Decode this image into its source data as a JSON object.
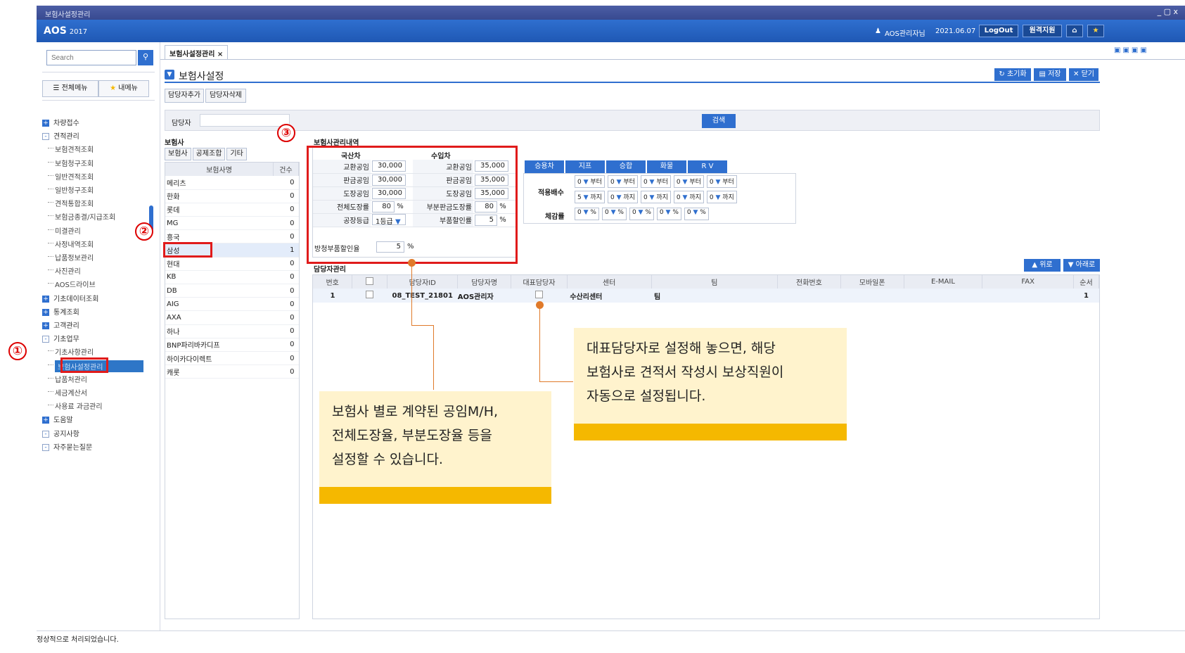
{
  "window": {
    "title": "보험사설정관리",
    "controls": "_ ▢ x"
  },
  "app": {
    "logo": "AOS",
    "year": "2017",
    "user": "AOS관리자님",
    "date": "2021.06.07",
    "logout": "LogOut",
    "remote": "원격지원"
  },
  "sidebar": {
    "search_placeholder": "Search",
    "tab_all": "전체메뉴",
    "tab_my": "내메뉴",
    "items": [
      {
        "label": "차량접수",
        "type": "plus"
      },
      {
        "label": "견적관리",
        "type": "minus"
      },
      {
        "label": "보험견적조회",
        "type": "sub"
      },
      {
        "label": "보험청구조회",
        "type": "sub"
      },
      {
        "label": "일반견적조회",
        "type": "sub"
      },
      {
        "label": "일반청구조회",
        "type": "sub"
      },
      {
        "label": "견적통합조회",
        "type": "sub"
      },
      {
        "label": "보험금종결/지급조회",
        "type": "sub"
      },
      {
        "label": "미결관리",
        "type": "sub"
      },
      {
        "label": "사정내역조회",
        "type": "sub"
      },
      {
        "label": "납품정보관리",
        "type": "sub"
      },
      {
        "label": "사진관리",
        "type": "sub"
      },
      {
        "label": "AOS드라이브",
        "type": "sub"
      },
      {
        "label": "기초데이터조회",
        "type": "plus"
      },
      {
        "label": "통계조회",
        "type": "plus"
      },
      {
        "label": "고객관리",
        "type": "plus"
      },
      {
        "label": "기초업무",
        "type": "minus"
      },
      {
        "label": "기초사항관리",
        "type": "sub"
      },
      {
        "label": "보험사설정관리",
        "type": "sub"
      },
      {
        "label": "납품처관리",
        "type": "sub"
      },
      {
        "label": "세금계산서",
        "type": "sub"
      },
      {
        "label": "사용료 과금관리",
        "type": "sub"
      },
      {
        "label": "도움말",
        "type": "plus"
      },
      {
        "label": "공지사항",
        "type": "minus"
      },
      {
        "label": "자주묻는질문",
        "type": "minus"
      }
    ]
  },
  "main": {
    "tab": "보험사설정관리 ×",
    "page_title": "보험사설정",
    "btn_reset": "초기화",
    "btn_save": "저장",
    "btn_close": "닫기",
    "btn_add_mgr": "담당자추가",
    "btn_del_mgr": "담당자삭제",
    "search_label": "담당자",
    "search_btn": "검색",
    "ins_section": "보험사",
    "ins_tabs": [
      "보험사",
      "공제조합",
      "기타"
    ],
    "ins_col_name": "보험사명",
    "ins_col_count": "건수",
    "insurers": [
      {
        "name": "메리츠",
        "count": "0"
      },
      {
        "name": "한화",
        "count": "0"
      },
      {
        "name": "롯데",
        "count": "0"
      },
      {
        "name": "MG",
        "count": "0"
      },
      {
        "name": "흥국",
        "count": "0"
      },
      {
        "name": "삼성",
        "count": "1"
      },
      {
        "name": "현대",
        "count": "0"
      },
      {
        "name": "KB",
        "count": "0"
      },
      {
        "name": "DB",
        "count": "0"
      },
      {
        "name": "AIG",
        "count": "0"
      },
      {
        "name": "AXA",
        "count": "0"
      },
      {
        "name": "하나",
        "count": "0"
      },
      {
        "name": "BNP파리바카디프",
        "count": "0"
      },
      {
        "name": "하이카다이렉트",
        "count": "0"
      },
      {
        "name": "캐롯",
        "count": "0"
      }
    ],
    "detail_title": "보험사관리내역",
    "dom_label": "국산차",
    "imp_label": "수입차",
    "rows": [
      {
        "l1": "교환공임",
        "v1": "30,000",
        "l2": "교환공임",
        "v2": "35,000"
      },
      {
        "l1": "판금공임",
        "v1": "30,000",
        "l2": "판금공임",
        "v2": "35,000"
      },
      {
        "l1": "도장공임",
        "v1": "30,000",
        "l2": "도장공임",
        "v2": "35,000"
      },
      {
        "l1": "전체도장률",
        "v1": "80",
        "l2": "부분판금도장률",
        "v2": "80"
      },
      {
        "l1": "공장등급",
        "v1": "1등급",
        "l2": "부품할인률",
        "v2": "5"
      }
    ],
    "rust_label": "방청부품할인율",
    "rust_value": "5",
    "pct": "%",
    "veh_tabs": [
      "승용차",
      "지프",
      "승합",
      "화물",
      "R V"
    ],
    "apply_label": "적용배수",
    "reduce_label": "체감률",
    "from": "부터",
    "to": "까지",
    "from_vals": [
      "0",
      "0",
      "0",
      "0",
      "0"
    ],
    "to_vals": [
      "5",
      "0",
      "0",
      "0",
      "0"
    ],
    "reduce_vals": [
      "0",
      "0",
      "0",
      "0",
      "0"
    ],
    "mgr_title": "담당자관리",
    "btn_up": "위로",
    "btn_down": "아래로",
    "mgr_cols": [
      "번호",
      "",
      "담당자ID",
      "담당자명",
      "대표담당자",
      "센터",
      "팀",
      "전화번호",
      "모바일폰",
      "E-MAIL",
      "FAX",
      "순서"
    ],
    "mgr_row": {
      "no": "1",
      "id": "08_TEST_21801",
      "name": "AOS관리자",
      "center": "수산리센터",
      "team": "팀",
      "order": "1"
    }
  },
  "status": "정상적으로 처리되었습니다.",
  "annotations": {
    "n1": "①",
    "n2": "②",
    "n3": "③",
    "callout_left": [
      "보험사 별로 계약된 공임M/H,",
      "전체도장율, 부분도장율 등을",
      "설정할 수 있습니다."
    ],
    "callout_right": [
      "대표담당자로 설정해 놓으면, 해당",
      "보험사로 견적서 작성시 보상직원이",
      "자동으로 설정됩니다."
    ]
  }
}
